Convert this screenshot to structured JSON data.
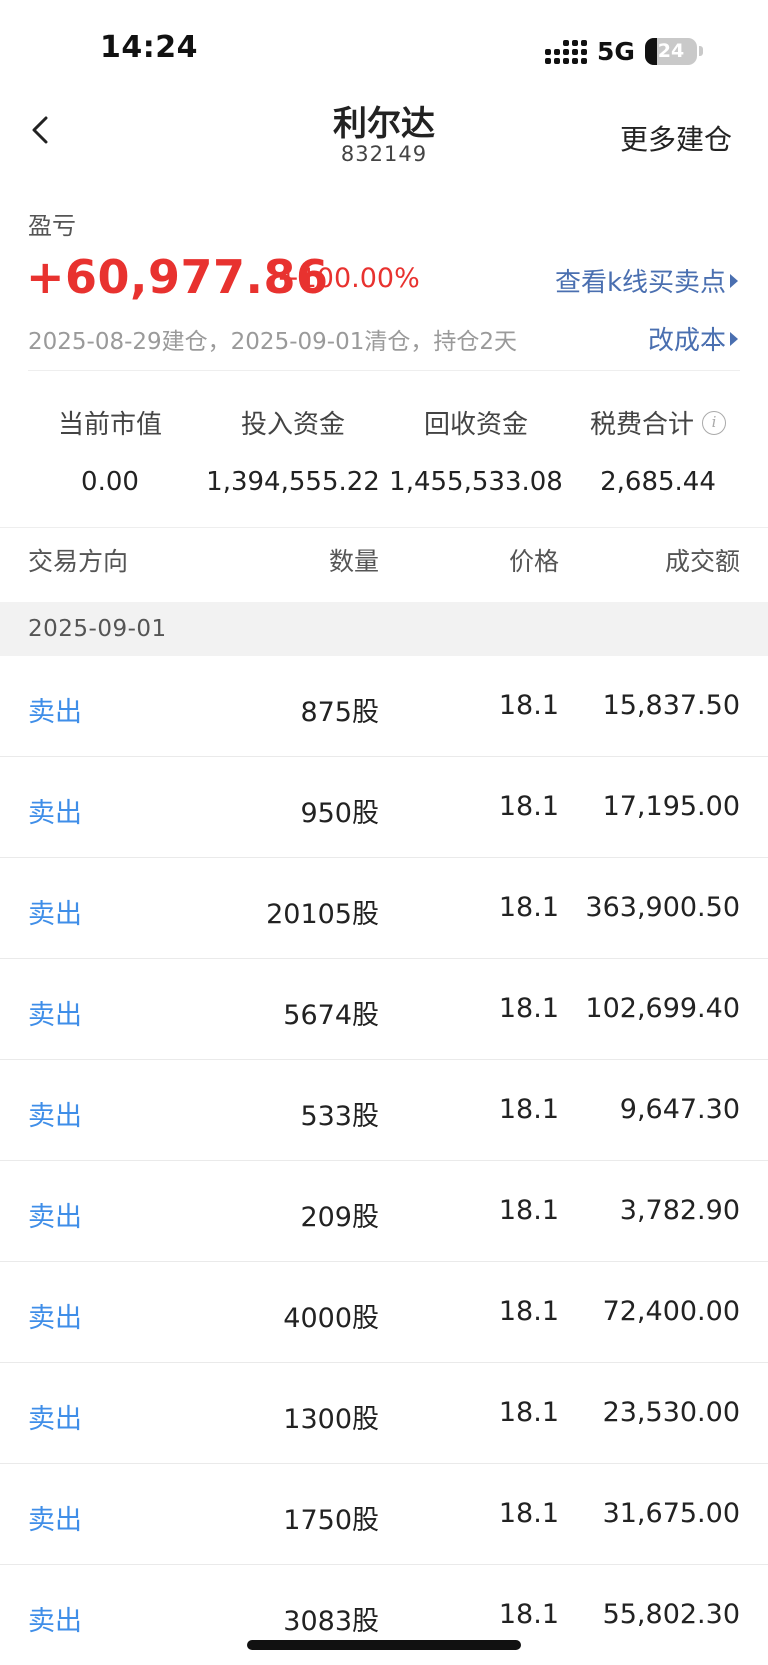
{
  "status_bar": {
    "time": "14:24",
    "network": "5G",
    "battery": "24",
    "battery_level": 0.24
  },
  "nav": {
    "title": "利尔达",
    "code": "832149",
    "action_label": "更多建仓"
  },
  "profit": {
    "label": "盈亏",
    "value": "+60,977.86",
    "percent": "+100.00%",
    "kline_link": "查看k线买卖点",
    "summary": "2025-08-29建仓，2025-09-01清仓，持仓2天",
    "cost_link": "改成本"
  },
  "stats": [
    {
      "label": "当前市值",
      "value": "0.00"
    },
    {
      "label": "投入资金",
      "value": "1,394,555.22"
    },
    {
      "label": "回收资金",
      "value": "1,455,533.08"
    },
    {
      "label": "税费合计",
      "value": "2,685.44"
    }
  ],
  "table": {
    "headers": {
      "direction": "交易方向",
      "quantity": "数量",
      "price": "价格",
      "amount": "成交额"
    },
    "date": "2025-09-01",
    "rows": [
      {
        "direction": "卖出",
        "quantity": "875股",
        "price": "18.1",
        "amount": "15,837.50"
      },
      {
        "direction": "卖出",
        "quantity": "950股",
        "price": "18.1",
        "amount": "17,195.00"
      },
      {
        "direction": "卖出",
        "quantity": "20105股",
        "price": "18.1",
        "amount": "363,900.50"
      },
      {
        "direction": "卖出",
        "quantity": "5674股",
        "price": "18.1",
        "amount": "102,699.40"
      },
      {
        "direction": "卖出",
        "quantity": "533股",
        "price": "18.1",
        "amount": "9,647.30"
      },
      {
        "direction": "卖出",
        "quantity": "209股",
        "price": "18.1",
        "amount": "3,782.90"
      },
      {
        "direction": "卖出",
        "quantity": "4000股",
        "price": "18.1",
        "amount": "72,400.00"
      },
      {
        "direction": "卖出",
        "quantity": "1300股",
        "price": "18.1",
        "amount": "23,530.00"
      },
      {
        "direction": "卖出",
        "quantity": "1750股",
        "price": "18.1",
        "amount": "31,675.00"
      },
      {
        "direction": "卖出",
        "quantity": "3083股",
        "price": "18.1",
        "amount": "55,802.30"
      }
    ]
  },
  "colors": {
    "profit_red": "#e8322f",
    "link_blue": "#4a6fb0",
    "sell_blue": "#3f8ee8"
  }
}
